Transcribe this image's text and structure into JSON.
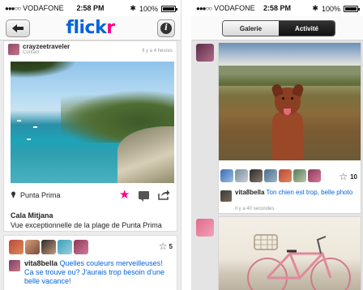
{
  "left_screen": {
    "status": {
      "carrier": "VODAFONE",
      "time": "2:58 PM",
      "battery": "100%"
    },
    "nav": {
      "logo_part1": "flick",
      "logo_part2": "r",
      "info_label": "i"
    },
    "owner": {
      "name": "crayzeetraveler",
      "relation": "Contact",
      "ago": "Il y a 4 heures"
    },
    "location": "Punta Prima",
    "title": "Cala Mitjana",
    "description": "Vue exceptionnelle de la plage de Punta Prima",
    "favorites_count": "5",
    "comment": {
      "author": "vita8bella",
      "text": " Quelles couleurs merveilleuses! Ca se trouve ou? J'aurais trop besoin d'une belle vacance!"
    },
    "colors": {
      "flickr_blue": "#0063dc",
      "flickr_pink": "#ff0084"
    }
  },
  "right_screen": {
    "status": {
      "carrier": "VODAFONE",
      "time": "2:58 PM",
      "battery": "100%"
    },
    "tabs": [
      {
        "label": "Galerie",
        "active": false
      },
      {
        "label": "Activité",
        "active": true
      }
    ],
    "activity": {
      "favorites_count": "10",
      "comment": {
        "author": "vita8bella",
        "text": " Ton chien est trop, belle photo"
      },
      "ago": "Il y a 40 secondes"
    }
  },
  "icons": [
    "back-arrow-icon",
    "info-icon",
    "pin-icon",
    "star-icon",
    "comment-icon",
    "share-icon",
    "bluetooth-icon",
    "battery-icon"
  ]
}
